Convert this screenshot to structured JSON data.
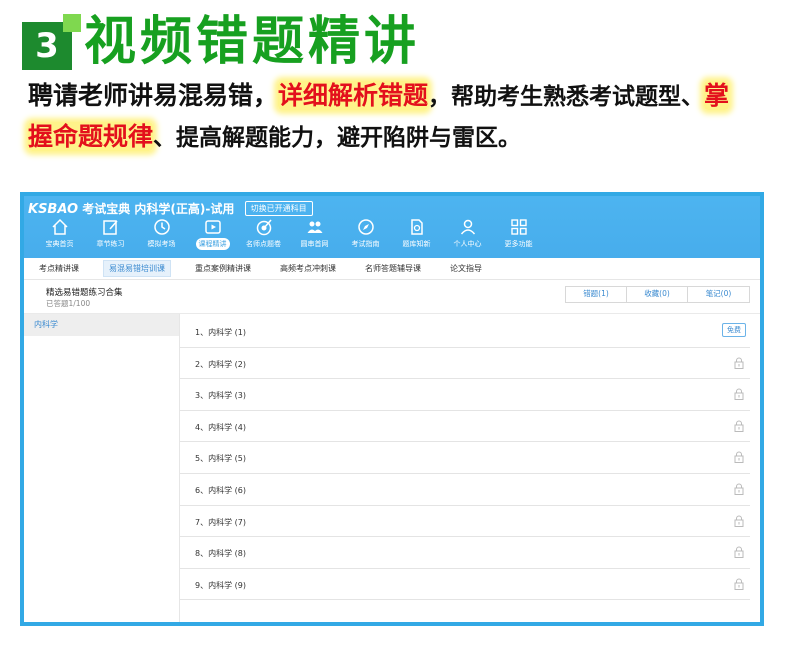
{
  "promo": {
    "number": "3",
    "title": "视频错题精讲",
    "desc": {
      "part1": "聘请老师讲易混易错，",
      "hl1": "详细解析错题",
      "part2": "，帮助考生熟悉考试题型、",
      "hl2a": "掌",
      "hl2b": "握命题规律",
      "part3": "、提高解题能力，避开陷阱与雷区。"
    }
  },
  "app": {
    "brand_logo": "KSBAO",
    "brand_text": "考试宝典 内科学(正高)-试用",
    "switch_label": "切换已开通科目",
    "nav": [
      {
        "label": "宝典首页",
        "icon": "home-icon"
      },
      {
        "label": "章节练习",
        "icon": "edit-icon"
      },
      {
        "label": "模拟考场",
        "icon": "clock-icon"
      },
      {
        "label": "课程精讲",
        "icon": "play-icon"
      },
      {
        "label": "名师点题卷",
        "icon": "target-icon"
      },
      {
        "label": "圆串首网",
        "icon": "people-icon"
      },
      {
        "label": "考试指南",
        "icon": "compass-icon"
      },
      {
        "label": "题库知新",
        "icon": "doc-icon"
      },
      {
        "label": "个人中心",
        "icon": "user-icon"
      },
      {
        "label": "更多功能",
        "icon": "grid-icon"
      }
    ],
    "subtabs": [
      "考点精讲课",
      "易混易错培训课",
      "重点案例精讲课",
      "高频考点冲刺课",
      "名师答题辅导课",
      "论文指导"
    ],
    "collection": {
      "title": "精选易错题练习合集",
      "progress": "已答题1/100",
      "buttons": [
        "错题(1)",
        "收藏(0)",
        "笔记(0)"
      ]
    },
    "sidebar": {
      "item": "内科学"
    },
    "rows": [
      {
        "label": "1、内科学 (1)",
        "free": "免费"
      },
      {
        "label": "2、内科学 (2)"
      },
      {
        "label": "3、内科学 (3)"
      },
      {
        "label": "4、内科学 (4)"
      },
      {
        "label": "5、内科学 (5)"
      },
      {
        "label": "6、内科学 (6)"
      },
      {
        "label": "7、内科学 (7)"
      },
      {
        "label": "8、内科学 (8)"
      },
      {
        "label": "9、内科学 (9)"
      }
    ],
    "colors": {
      "accent": "#47adec",
      "border": "#32a9e5",
      "title_green": "#17a020",
      "highlight_red": "#e3101c"
    }
  }
}
